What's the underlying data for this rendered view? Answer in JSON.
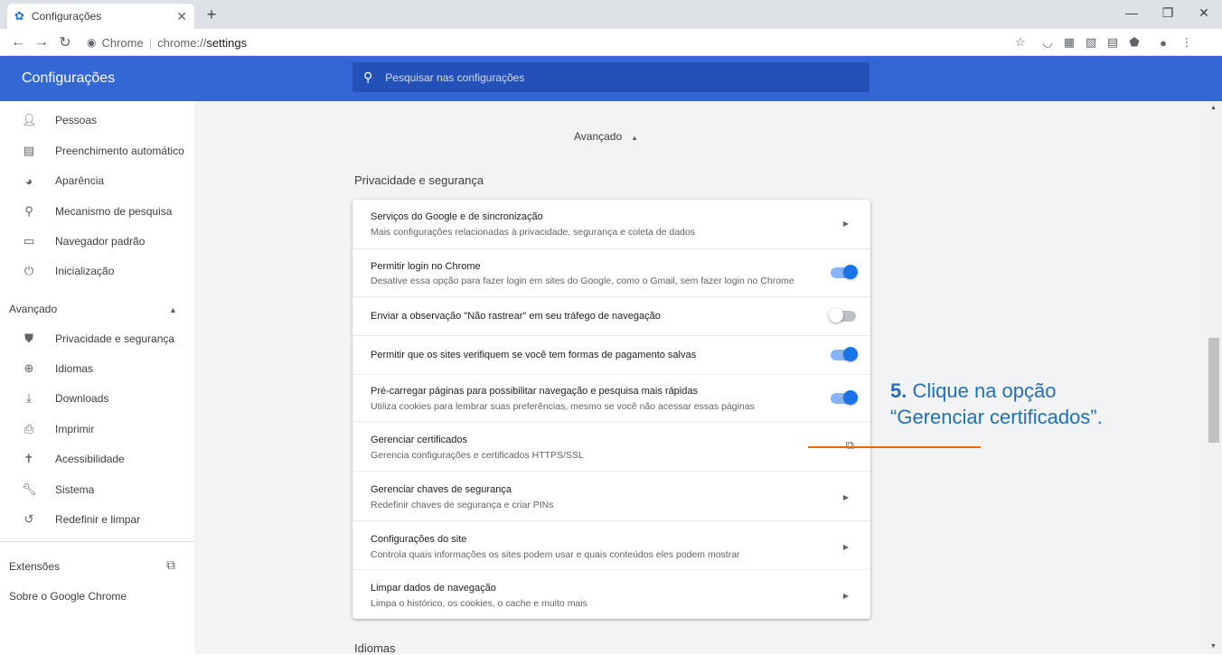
{
  "browser": {
    "tab_title": "Configurações",
    "tab_icon": "gear-icon",
    "omnibox_site": "Chrome",
    "omnibox_separator": "|",
    "omnibox_scheme": "chrome://",
    "omnibox_path": "settings"
  },
  "header": {
    "title": "Configurações",
    "search_placeholder": "Pesquisar nas configurações"
  },
  "sidebar": {
    "items": [
      {
        "label": "Pessoas",
        "icon": "person-icon"
      },
      {
        "label": "Preenchimento automático",
        "icon": "clipboard-icon"
      },
      {
        "label": "Aparência",
        "icon": "palette-icon"
      },
      {
        "label": "Mecanismo de pesquisa",
        "icon": "search-icon"
      },
      {
        "label": "Navegador padrão",
        "icon": "browser-window-icon"
      },
      {
        "label": "Inicialização",
        "icon": "power-icon"
      }
    ],
    "advanced_label": "Avançado",
    "advanced_items": [
      {
        "label": "Privacidade e segurança",
        "icon": "shield-icon"
      },
      {
        "label": "Idiomas",
        "icon": "globe-icon"
      },
      {
        "label": "Downloads",
        "icon": "download-icon"
      },
      {
        "label": "Imprimir",
        "icon": "printer-icon"
      },
      {
        "label": "Acessibilidade",
        "icon": "accessibility-icon"
      },
      {
        "label": "Sistema",
        "icon": "wrench-icon"
      },
      {
        "label": "Redefinir e limpar",
        "icon": "restore-icon"
      }
    ],
    "extensions_label": "Extensões",
    "about_label": "Sobre o Google Chrome"
  },
  "main": {
    "advanced_toggle": "Avançado",
    "section_title": "Privacidade e segurança",
    "rows": [
      {
        "label": "Serviços do Google e de sincronização",
        "sub": "Mais configurações relacionadas à privacidade, segurança e coleta de dados",
        "control": "chevron"
      },
      {
        "label": "Permitir login no Chrome",
        "sub": "Desative essa opção para fazer login em sites do Google, como o Gmail, sem fazer login no Chrome",
        "control": "toggle",
        "on": true
      },
      {
        "label": "Enviar a observação \"Não rastrear\" em seu tráfego de navegação",
        "sub": "",
        "control": "toggle",
        "on": false
      },
      {
        "label": "Permitir que os sites verifiquem se você tem formas de pagamento salvas",
        "sub": "",
        "control": "toggle",
        "on": true
      },
      {
        "label": "Pré-carregar páginas para possibilitar navegação e pesquisa mais rápidas",
        "sub": "Utiliza cookies para lembrar suas preferências, mesmo se você não acessar essas páginas",
        "control": "toggle",
        "on": true
      },
      {
        "label": "Gerenciar certificados",
        "sub": "Gerencia configurações e certificados HTTPS/SSL",
        "control": "external"
      },
      {
        "label": "Gerenciar chaves de segurança",
        "sub": "Redefinir chaves de segurança e criar PINs",
        "control": "chevron"
      },
      {
        "label": "Configurações do site",
        "sub": "Controla quais informações os sites podem usar e quais conteúdos eles podem mostrar",
        "control": "chevron"
      },
      {
        "label": "Limpar dados de navegação",
        "sub": "Limpa o histórico, os cookies, o cache e muito mais",
        "control": "chevron"
      }
    ],
    "next_section_title": "Idiomas"
  },
  "annotation": {
    "step": "5.",
    "line1": "Clique na opção",
    "line2": "“Gerenciar certificados”."
  },
  "colors": {
    "header": "#3367d6",
    "toggle_on": "#1a73e8",
    "annotation_text": "#1f70c1",
    "annotation_line": "#e46c0a"
  }
}
